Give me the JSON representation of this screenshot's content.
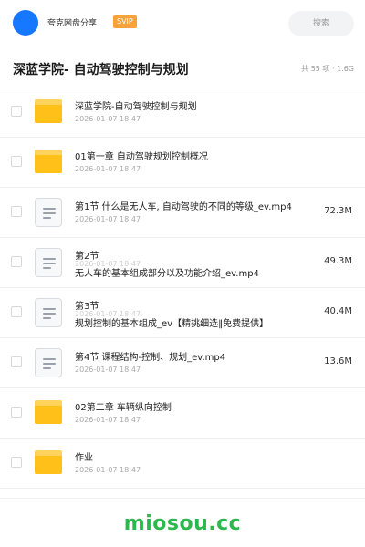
{
  "header": {
    "user_name": "夸克网盘分享",
    "badge": "SVIP",
    "search_placeholder": "搜索"
  },
  "title_bar": {
    "title": "深蓝学院- 自动驾驶控制与规划",
    "meta": "共 55 项 · 1.6G"
  },
  "files": [
    {
      "type": "folder",
      "name": "深蓝学院-自动驾驶控制与规划",
      "date": "2026-01-07 18:47",
      "size": ""
    },
    {
      "type": "folder",
      "name": "01第一章 自动驾驶规划控制概况",
      "date": "2026-01-07 18:47",
      "size": ""
    },
    {
      "type": "video",
      "name": "第1节 什么是无人车, 自动驾驶的不同的等级_ev.mp4",
      "date": "2026-01-07 18:47",
      "size": "72.3M"
    },
    {
      "type": "video",
      "name": "第2节",
      "name_sub": "无人车的基本组成部分以及功能介绍_ev.mp4",
      "date": "2026-01-07 18:47",
      "size": "49.3M"
    },
    {
      "type": "video",
      "name": "第3节",
      "name_sub": "规划控制的基本组成_ev【精挑细选‖免费提供】",
      "date": "2026-01-07 18:47",
      "size": "40.4M"
    },
    {
      "type": "video",
      "name": "第4节 课程结构-控制、规划_ev.mp4",
      "date": "2026-01-07 18:47",
      "size": "13.6M"
    },
    {
      "type": "folder",
      "name": "02第二章 车辆纵向控制",
      "date": "2026-01-07 18:47",
      "size": ""
    },
    {
      "type": "folder",
      "name": "作业",
      "date": "2026-01-07 18:47",
      "size": ""
    }
  ],
  "footer": {
    "watermark": "miosou.cc"
  },
  "colors": {
    "avatar": "#1677ff",
    "badge": "#f7a23a",
    "folder": "#ffc119",
    "watermark": "#2db84d"
  }
}
